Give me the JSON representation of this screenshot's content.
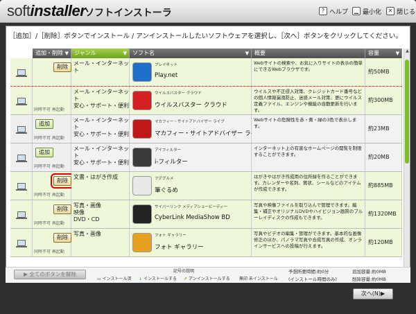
{
  "window": {
    "logo_thin": "soft",
    "logo_bold": "installer",
    "title": "ソフトインストーラ",
    "help": "ヘルプ",
    "minimize": "最小化",
    "close": "閉じる"
  },
  "instruction": "［追加］/［削除］ボタンでインストール / アンインストールしたいソフトウェアを選択し、［次へ］ボタンをクリックしてください。",
  "columns": {
    "action": "追加・削除",
    "genre": "ジャンル",
    "name": "ソフト名",
    "desc": "概要",
    "size": "容量"
  },
  "rows": [
    {
      "action": "削除",
      "type": "del",
      "genre": "メール・インターネット",
      "small": "プレイネット",
      "name": "Play.net",
      "desc": "Webサイトの検索や、お気に入りサイトの表示の簡単にできるWebブラウザです。",
      "size": "約50MB",
      "opts": "",
      "icon_color": "#1e6fc8"
    },
    {
      "action": "",
      "type": "none",
      "genre": "メール・インターネット\n安心・サポート・便利",
      "small": "ウイルスバスター クラウド",
      "name": "ウイルスバスター クラウド",
      "desc": "ウイルスや不正侵入対策、クレジットカード番号などの個人情報漏洩防止、迷惑メール対策、更にウイルス定義ファイル、エンジンや機能の自動更新を行います。",
      "size": "約300MB",
      "opts": "同時不可  再起動",
      "icon_color": "#d42020"
    },
    {
      "action": "追加",
      "type": "add",
      "genre": "メール・インターネット\n安心・サポート・便利",
      "small": "マカフィー・サイトアドバイザー ライブ",
      "name": "マカフィー・サイトアドバイザー ライブ",
      "desc": "Webサイトの危険性を赤・黄・緑の3色で表示します。",
      "size": "約23MB",
      "opts": "同時不可  再起動",
      "icon_color": "#c01818"
    },
    {
      "action": "追加",
      "type": "add",
      "genre": "メール・インターネット\n安心・サポート・便利",
      "small": "アイフィルター",
      "name": "i-フィルター",
      "desc": "インターネット上の有害なホームページの閲覧を制限することができます。",
      "size": "約20MB",
      "opts": "同時不可  再起動",
      "icon_color": "#3a3a3a"
    },
    {
      "action": "削除",
      "type": "del",
      "genre": "文書・はがき作成",
      "small": "フデグルメ",
      "name": "筆ぐるめ",
      "desc": "はがきやはがき作成用の住所録を作ることができます。カレンダーや名刺、賞状、シールなどのアイテムが作成できます。",
      "size": "約885MB",
      "opts": "同時不可  再起動",
      "icon_color": "#e8e8e8"
    },
    {
      "action": "削除",
      "type": "del",
      "genre": "写真・画像\n映像\nDVD・CD",
      "small": "サイバーリンク メディアショービーディー",
      "name": "CyberLink MediaShow BD",
      "desc": "写真や映像ファイルを取り込んで管理できます。編集・補正やオリジナルDVDやハイビジョン画質のブルーレイディスクの作成もできます。",
      "size": "約1320MB",
      "opts": "同時不可  再起動",
      "icon_color": "#222222"
    },
    {
      "action": "削除",
      "type": "del",
      "genre": "写真・画像",
      "small": "フォト ギャラリー",
      "name": "フォト ギャラリー",
      "desc": "写真やビデオの編集・管理ができます。基本的な画像修正のほか、パノラマ写真や合成写真の作成、オンラインサービスへの投稿が行えます。",
      "size": "約120MB",
      "opts": "同時不可  再起動",
      "icon_color": "#e8a020"
    }
  ],
  "footer": {
    "all_button": "▶ 全てのボタンを解除",
    "legend_title": "記号の説明",
    "legend_installed": "インストール済",
    "legend_install": "インストールする",
    "legend_uninstall": "アンインストールする",
    "legend_none": "無印  未インストール",
    "est_time": "予想所要時間:約0分",
    "est_note": "(インストール時間のみ)",
    "added": "追加容量:約0MB",
    "removed": "削除容量:約0MB",
    "next": "次へ(N)▶"
  }
}
